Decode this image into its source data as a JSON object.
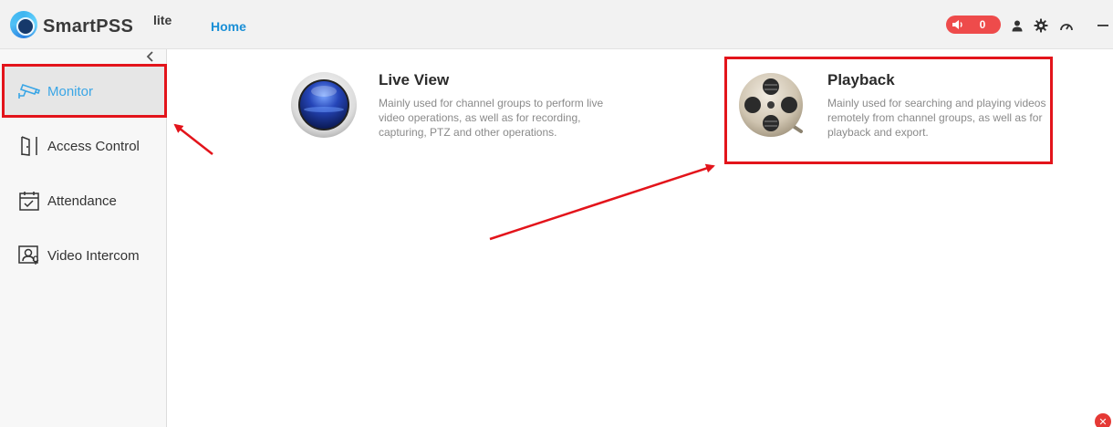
{
  "app": {
    "name": "SmartPSS",
    "name_sup": "lite",
    "logo_icon": "smartpss-logo-icon"
  },
  "header": {
    "nav_home": "Home",
    "alarm_count": "0",
    "alarm_icon": "speaker-icon",
    "icons": [
      "user-icon",
      "gear-icon",
      "gauge-icon",
      "minimize-icon"
    ]
  },
  "sidebar": {
    "collapse_icon": "chevron-left-icon",
    "items": [
      {
        "label": "Monitor",
        "icon": "cctv-camera-icon",
        "active": true
      },
      {
        "label": "Access Control",
        "icon": "door-icon",
        "active": false
      },
      {
        "label": "Attendance",
        "icon": "calendar-check-icon",
        "active": false
      },
      {
        "label": "Video Intercom",
        "icon": "intercom-icon",
        "active": false
      }
    ]
  },
  "main": {
    "cards": [
      {
        "title": "Live View",
        "description": "Mainly used for channel groups to perform live video operations, as well as for recording, capturing, PTZ and other operations.",
        "icon": "live-view-lens-icon"
      },
      {
        "title": "Playback",
        "description": "Mainly used for searching and playing videos remotely from channel groups, as well as for playback and export.",
        "icon": "film-reel-icon"
      }
    ]
  },
  "colors": {
    "accent": "#1a8fd6",
    "active_label": "#3aa6e6",
    "alarm": "#ee4b4b",
    "annotation": "#e3141b"
  }
}
